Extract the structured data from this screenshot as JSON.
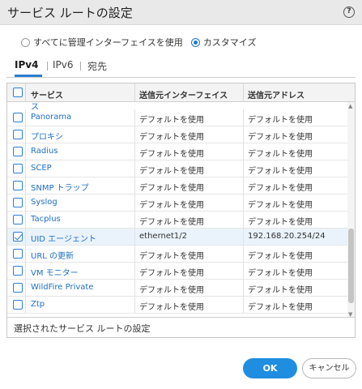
{
  "dialog": {
    "title": "サービス ルートの設定",
    "help_label": "?"
  },
  "mode": {
    "options": [
      {
        "label": "すべてに管理インターフェイスを使用",
        "selected": false
      },
      {
        "label": "カスタマイズ",
        "selected": true
      }
    ]
  },
  "tabs": [
    {
      "label": "IPv4",
      "active": true
    },
    {
      "label": "IPv6",
      "active": false
    },
    {
      "label": "宛先",
      "active": false
    }
  ],
  "table": {
    "columns": [
      "サービス",
      "送信元インターフェイス",
      "送信元アドレス"
    ],
    "partial_row_text": "ス",
    "rows": [
      {
        "service": "Panorama",
        "interface": "デフォルトを使用",
        "address": "デフォルトを使用",
        "checked": false
      },
      {
        "service": "プロキシ",
        "interface": "デフォルトを使用",
        "address": "デフォルトを使用",
        "checked": false
      },
      {
        "service": "Radius",
        "interface": "デフォルトを使用",
        "address": "デフォルトを使用",
        "checked": false
      },
      {
        "service": "SCEP",
        "interface": "デフォルトを使用",
        "address": "デフォルトを使用",
        "checked": false
      },
      {
        "service": "SNMP トラップ",
        "interface": "デフォルトを使用",
        "address": "デフォルトを使用",
        "checked": false
      },
      {
        "service": "Syslog",
        "interface": "デフォルトを使用",
        "address": "デフォルトを使用",
        "checked": false
      },
      {
        "service": "Tacplus",
        "interface": "デフォルトを使用",
        "address": "デフォルトを使用",
        "checked": false
      },
      {
        "service": "UID エージェント",
        "interface": "ethernet1/2",
        "address": "192.168.20.254/24",
        "checked": true
      },
      {
        "service": "URL の更新",
        "interface": "デフォルトを使用",
        "address": "デフォルトを使用",
        "checked": false
      },
      {
        "service": "VM モニター",
        "interface": "デフォルトを使用",
        "address": "デフォルトを使用",
        "checked": false
      },
      {
        "service": "WildFire Private",
        "interface": "デフォルトを使用",
        "address": "デフォルトを使用",
        "checked": false
      },
      {
        "service": "Ztp",
        "interface": "デフォルトを使用",
        "address": "デフォルトを使用",
        "checked": false
      }
    ],
    "footer_action": "選択されたサービス ルートの設定"
  },
  "buttons": {
    "ok": "OK",
    "cancel": "キャンセル"
  },
  "colors": {
    "accent": "#1f8ee0",
    "link": "#1f6fc4",
    "selected_row": "#eaf3fb"
  }
}
